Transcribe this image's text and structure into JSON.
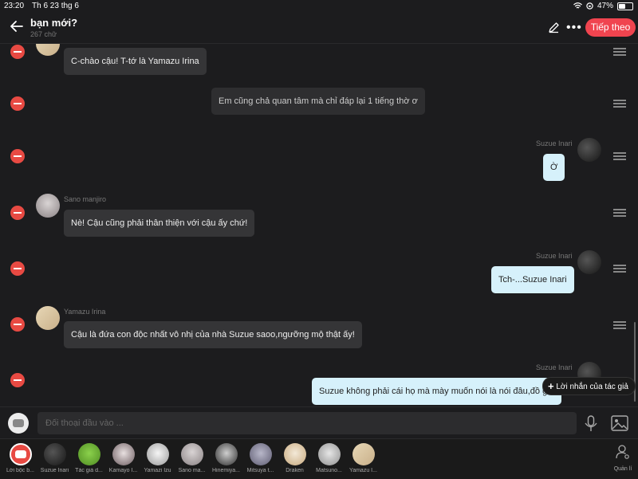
{
  "status": {
    "time": "23:20",
    "date": "Th 6 23 thg 6",
    "battery": "47%",
    "battery_level": 0.47
  },
  "header": {
    "title": "bạn mới?",
    "subtitle": "267 chữ",
    "next_label": "Tiếp theo"
  },
  "messages": [
    {
      "speaker": "",
      "text": "C-chào cậu! T-tớ là Yamazu Irina"
    },
    {
      "speaker": "",
      "text": "Em cũng chả quan tâm mà chỉ đáp lại 1 tiếng thờ ơ"
    },
    {
      "speaker": "Suzue Inari",
      "text": "Ờ"
    },
    {
      "speaker": "Sano manjiro",
      "text": "Nè! Cậu cũng phải thân thiện với cậu ấy chứ!"
    },
    {
      "speaker": "Suzue Inari",
      "text": "Tch-...Suzue Inari"
    },
    {
      "speaker": "Yamazu Irina",
      "text": "Cậu là đứa con độc nhất vô nhị của nhà Suzue saoo,ngưỡng mộ thật ấy!"
    },
    {
      "speaker": "Suzue Inari",
      "text": "Suzue không phải cái họ mà mày muốn nói là nói đâu,đồ gái"
    }
  ],
  "tooltip": {
    "label": "Lời nhắn của tác giả"
  },
  "input": {
    "placeholder": "Đối thoại đầu vào ..."
  },
  "characters": [
    "Lời bộc b...",
    "Suzue Inari",
    "Tác giả d...",
    "Kamayo I...",
    "Yamazi Izu",
    "Sano ma...",
    "Hinemiya...",
    "Mitsuya t...",
    "Draken",
    "Matsuno...",
    "Yamazu I..."
  ],
  "manage_label": "Quản lí",
  "colors": {
    "accent": "#f0444f",
    "delete": "#e84a43",
    "self_bubble": "#d6f1fb",
    "other_bubble": "#353537"
  }
}
